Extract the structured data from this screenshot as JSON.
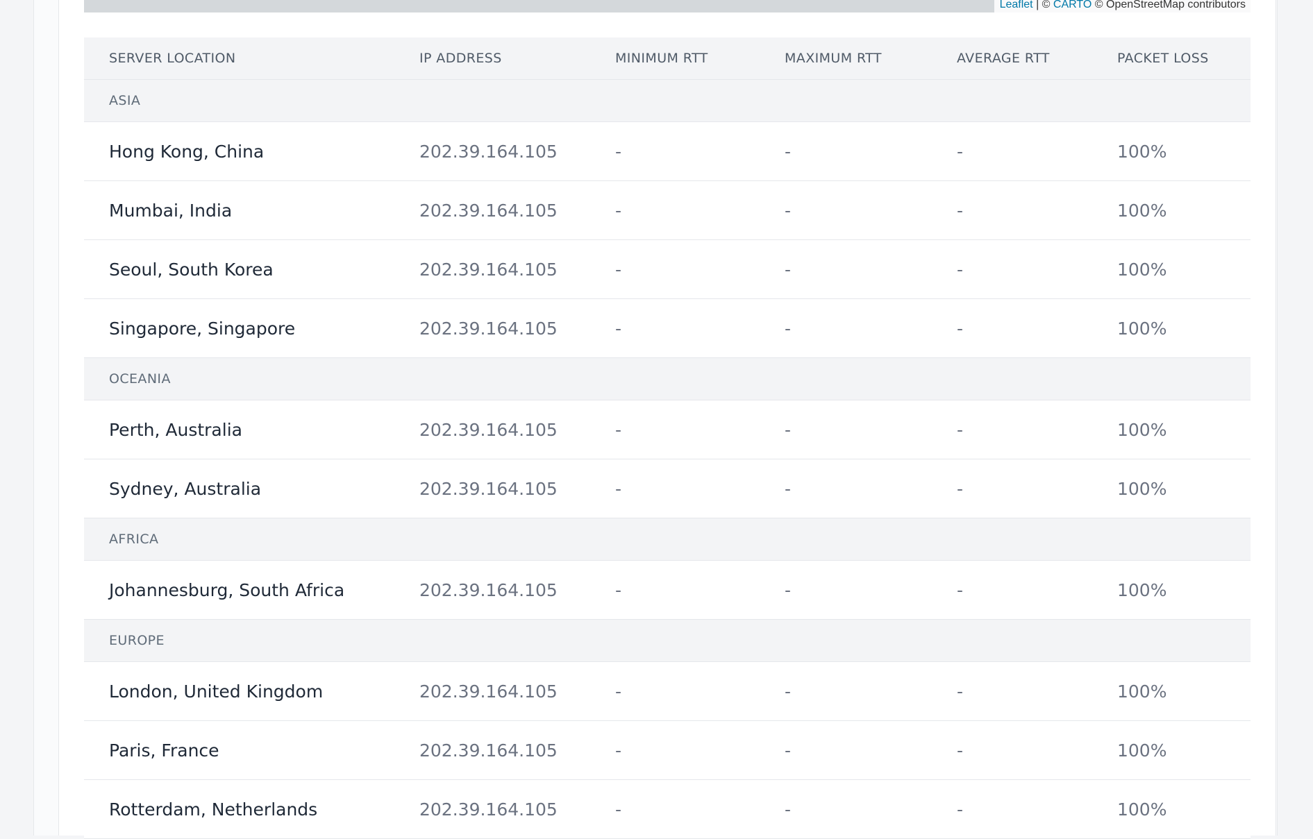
{
  "map": {
    "attribution": {
      "leaflet": "Leaflet",
      "sep1": " | © ",
      "carto": "CARTO",
      "osm": " © OpenStreetMap contributors"
    }
  },
  "table": {
    "headers": {
      "location": "SERVER LOCATION",
      "ip": "IP ADDRESS",
      "min": "MINIMUM RTT",
      "max": "MAXIMUM RTT",
      "avg": "AVERAGE RTT",
      "loss": "PACKET LOSS"
    },
    "groups": [
      {
        "name": "ASIA",
        "rows": [
          {
            "location": "Hong Kong, China",
            "ip": "202.39.164.105",
            "min": "-",
            "max": "-",
            "avg": "-",
            "loss": "100%"
          },
          {
            "location": "Mumbai, India",
            "ip": "202.39.164.105",
            "min": "-",
            "max": "-",
            "avg": "-",
            "loss": "100%"
          },
          {
            "location": "Seoul, South Korea",
            "ip": "202.39.164.105",
            "min": "-",
            "max": "-",
            "avg": "-",
            "loss": "100%"
          },
          {
            "location": "Singapore, Singapore",
            "ip": "202.39.164.105",
            "min": "-",
            "max": "-",
            "avg": "-",
            "loss": "100%"
          }
        ]
      },
      {
        "name": "OCEANIA",
        "rows": [
          {
            "location": "Perth, Australia",
            "ip": "202.39.164.105",
            "min": "-",
            "max": "-",
            "avg": "-",
            "loss": "100%"
          },
          {
            "location": "Sydney, Australia",
            "ip": "202.39.164.105",
            "min": "-",
            "max": "-",
            "avg": "-",
            "loss": "100%"
          }
        ]
      },
      {
        "name": "AFRICA",
        "rows": [
          {
            "location": "Johannesburg, South Africa",
            "ip": "202.39.164.105",
            "min": "-",
            "max": "-",
            "avg": "-",
            "loss": "100%"
          }
        ]
      },
      {
        "name": "EUROPE",
        "rows": [
          {
            "location": "London, United Kingdom",
            "ip": "202.39.164.105",
            "min": "-",
            "max": "-",
            "avg": "-",
            "loss": "100%"
          },
          {
            "location": "Paris, France",
            "ip": "202.39.164.105",
            "min": "-",
            "max": "-",
            "avg": "-",
            "loss": "100%"
          },
          {
            "location": "Rotterdam, Netherlands",
            "ip": "202.39.164.105",
            "min": "-",
            "max": "-",
            "avg": "-",
            "loss": "100%"
          }
        ]
      }
    ]
  },
  "colors": {
    "header_bg": "#f3f4f6",
    "link": "#0078a8",
    "location_text": "#1f2937",
    "value_text": "#6b7280"
  }
}
